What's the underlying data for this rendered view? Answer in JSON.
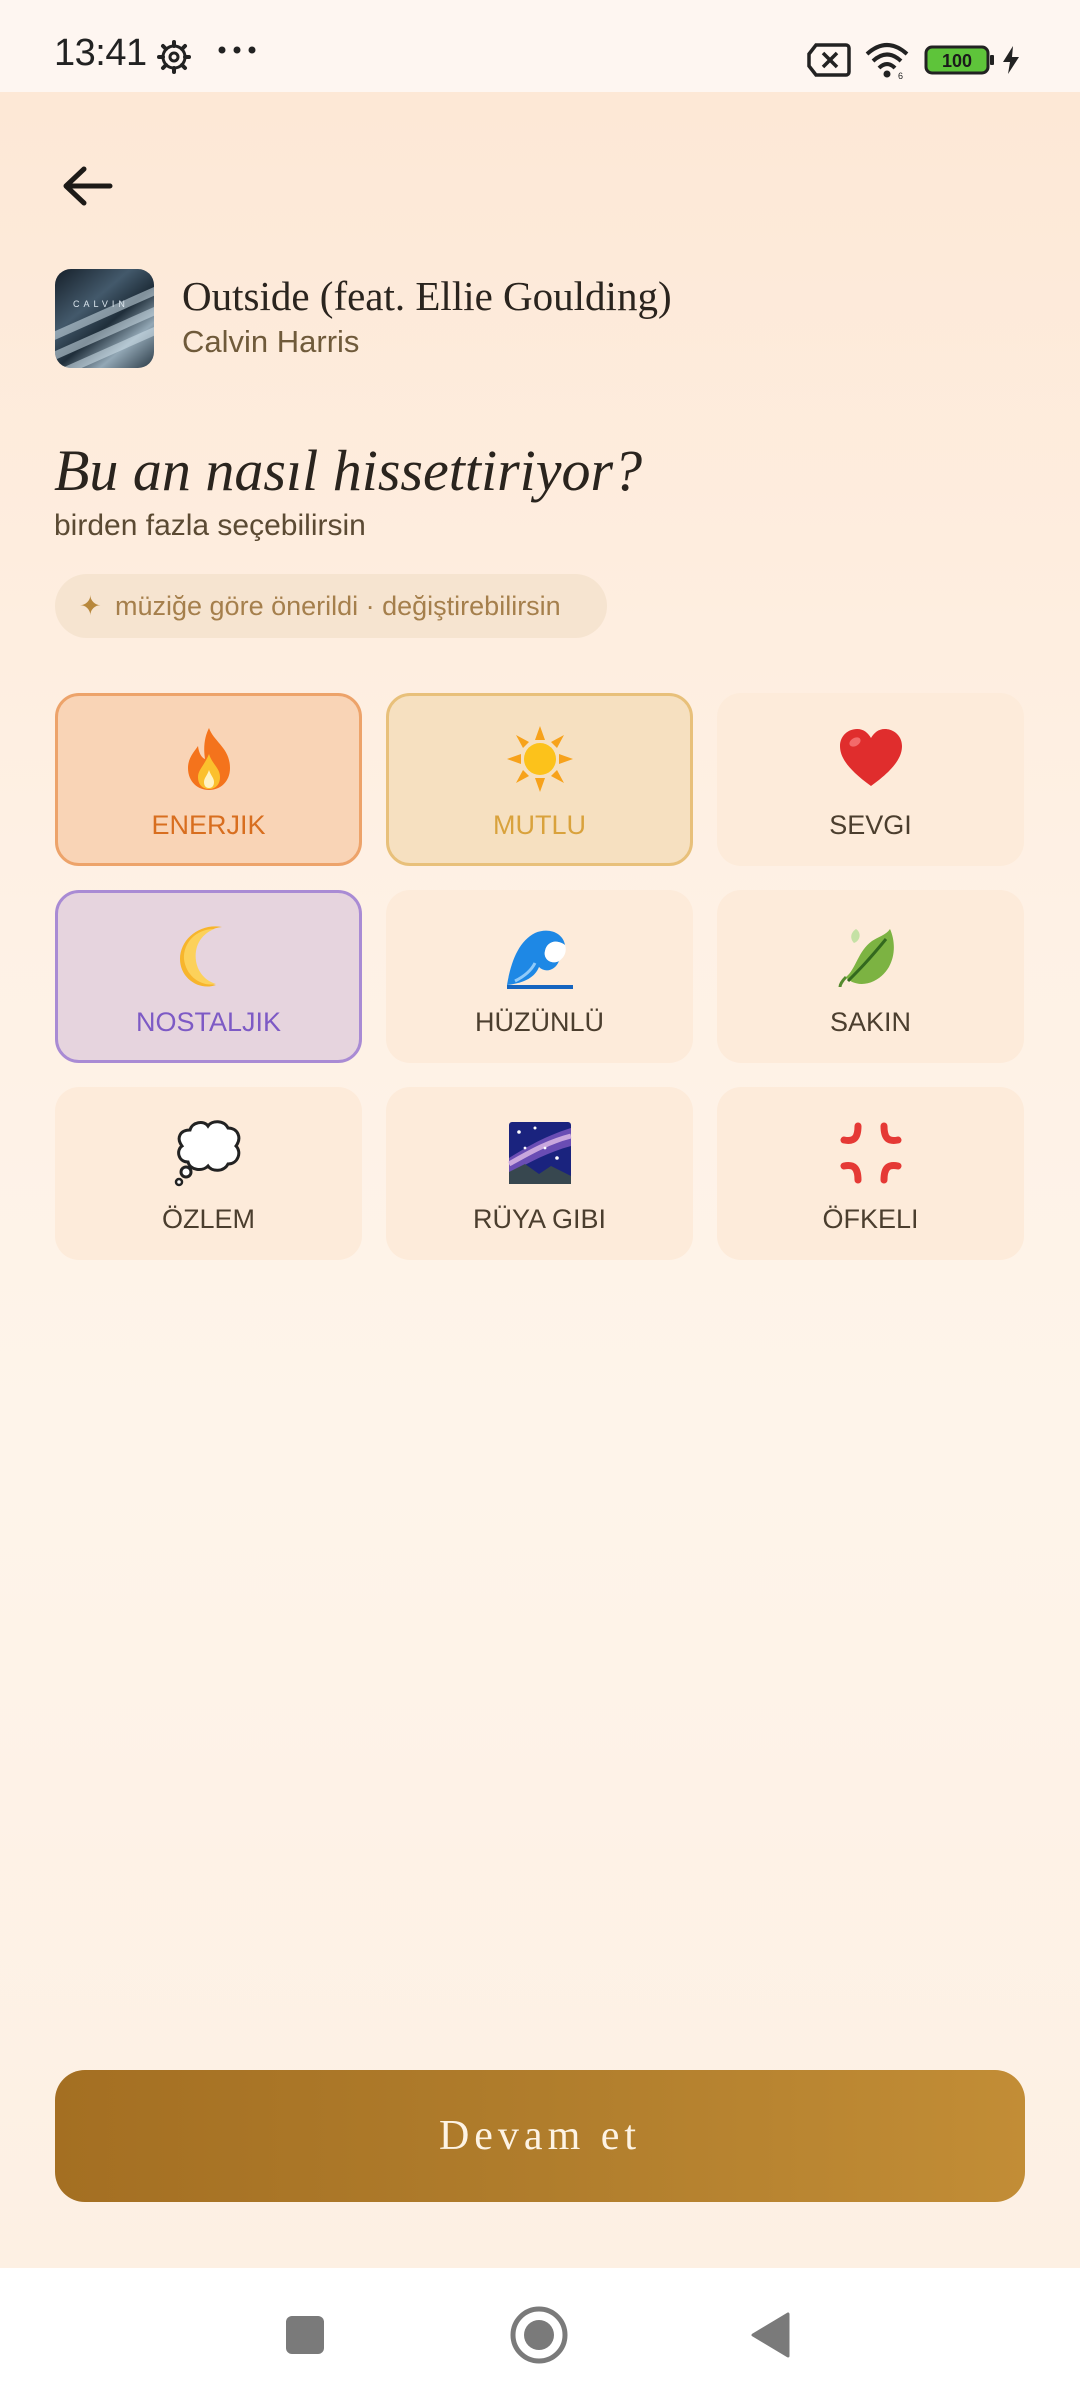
{
  "status_bar": {
    "time": "13:41",
    "battery_level": "100",
    "icons": [
      "gear-icon",
      "more-dots-icon",
      "no-sim-icon",
      "wifi-icon",
      "battery-icon",
      "charging-bolt-icon"
    ]
  },
  "header": {
    "back_icon": "arrow-left-icon"
  },
  "song": {
    "title": "Outside (feat. Ellie Goulding)",
    "artist": "Calvin Harris",
    "art_text": "CALVIN"
  },
  "prompt": {
    "title": "Bu an nasıl hissettiriyor?",
    "subtitle": "birden fazla seçebilirsin"
  },
  "suggestion": {
    "icon": "✦",
    "text": "müziğe göre önerildi · değiştirebilirsin"
  },
  "moods": [
    {
      "label": "ENERJIK",
      "icon": "fire-icon",
      "selected": true,
      "accent": "#d86e1f"
    },
    {
      "label": "MUTLU",
      "icon": "sun-icon",
      "selected": true,
      "accent": "#d9a23c"
    },
    {
      "label": "SEVGI",
      "icon": "heart-icon",
      "selected": false
    },
    {
      "label": "NOSTALJIK",
      "icon": "crescent-moon-icon",
      "selected": true,
      "accent": "#7d5ac5"
    },
    {
      "label": "HÜZÜNLÜ",
      "icon": "wave-icon",
      "selected": false
    },
    {
      "label": "SAKIN",
      "icon": "leaf-icon",
      "selected": false
    },
    {
      "label": "ÖZLEM",
      "icon": "thought-bubble-icon",
      "selected": false
    },
    {
      "label": "RÜYA GIBI",
      "icon": "milky-way-icon",
      "selected": false
    },
    {
      "label": "ÖFKELI",
      "icon": "anger-symbol-icon",
      "selected": false
    }
  ],
  "footer": {
    "continue_label": "Devam et"
  },
  "nav_bar": {
    "icons": [
      "recents-square-icon",
      "home-circle-icon",
      "back-triangle-icon"
    ]
  },
  "colors": {
    "background": "#fde8d6",
    "accent_gold": "#b07d2c",
    "card": "#fdebda"
  }
}
